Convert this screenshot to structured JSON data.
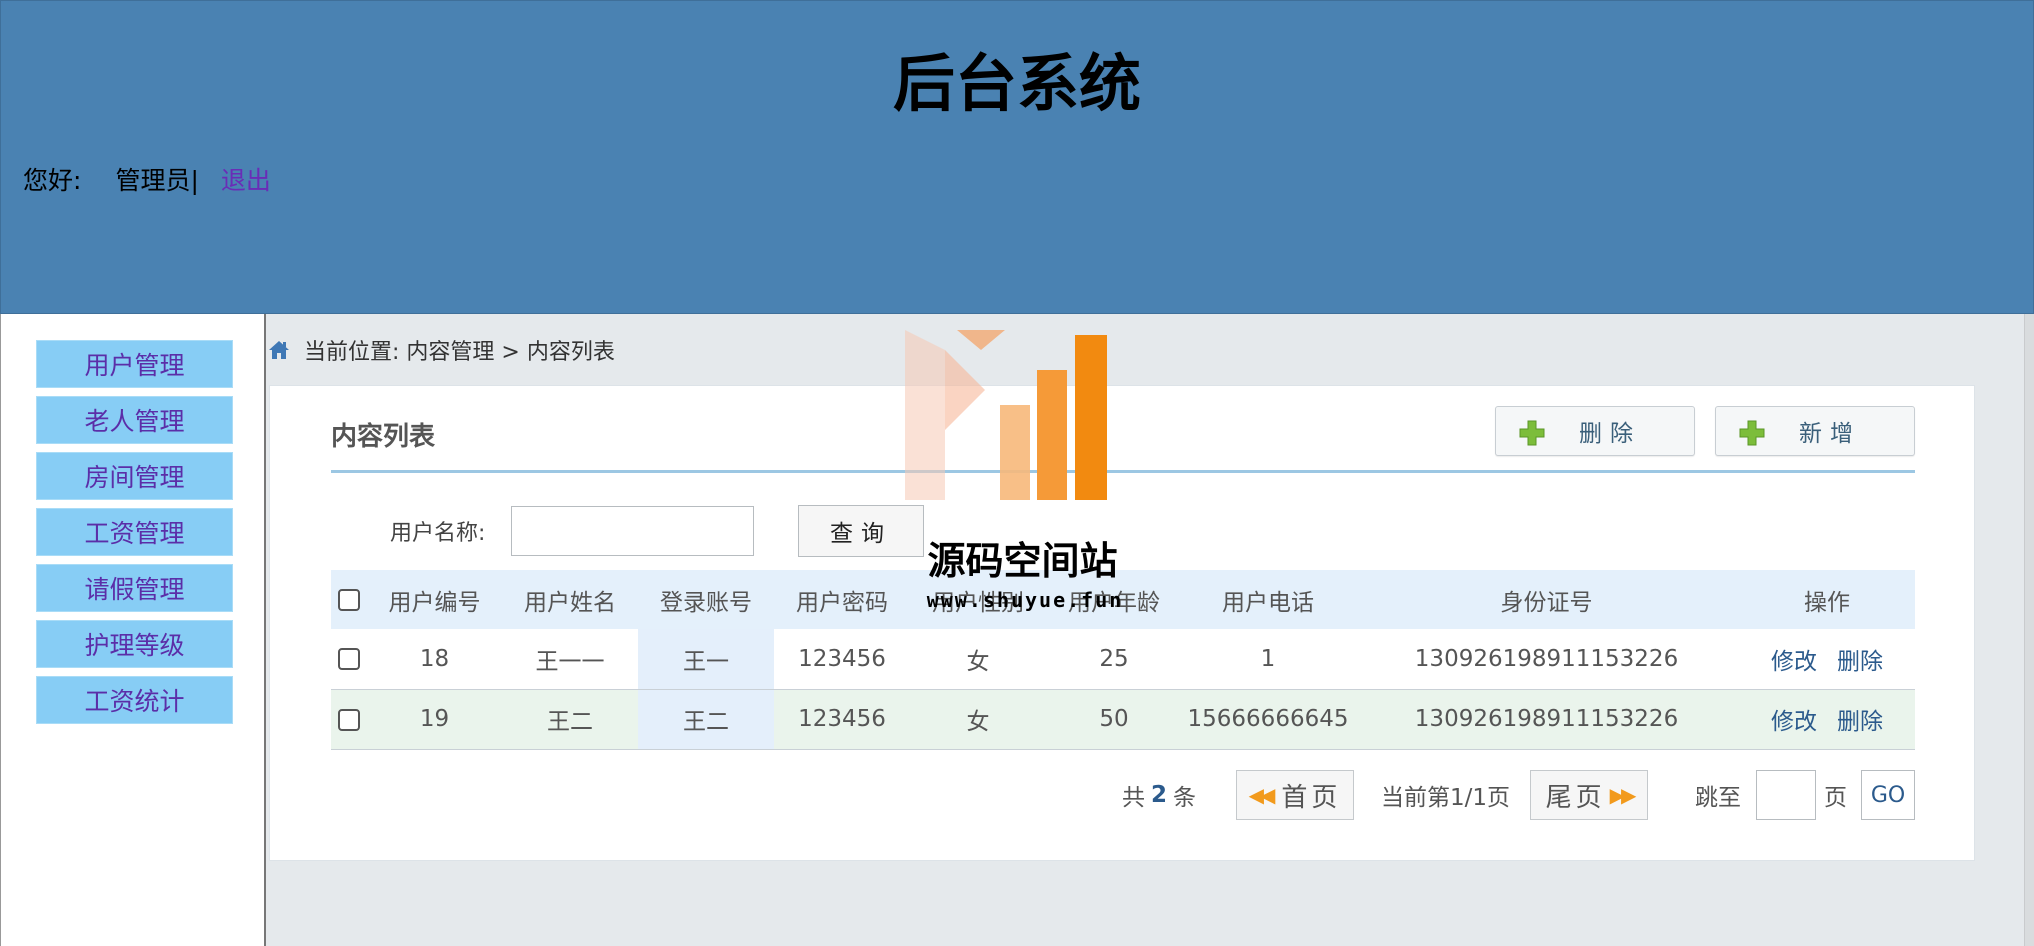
{
  "header": {
    "title": "后台系统",
    "greeting": "您好:",
    "user": "管理员|",
    "logout": "退出"
  },
  "sidebar": {
    "items": [
      {
        "label": "用户管理"
      },
      {
        "label": "老人管理"
      },
      {
        "label": "房间管理"
      },
      {
        "label": "工资管理"
      },
      {
        "label": "请假管理"
      },
      {
        "label": "护理等级"
      },
      {
        "label": "工资统计"
      }
    ]
  },
  "breadcrumb": "当前位置: 内容管理 > 内容列表",
  "panel": {
    "title": "内容列表",
    "delete_label": "删除",
    "add_label": "新增"
  },
  "search": {
    "label": "用户名称:",
    "value": "",
    "placeholder": "",
    "button": "查询"
  },
  "table": {
    "headers": [
      "用户编号",
      "用户姓名",
      "登录账号",
      "用户密码",
      "用户性别",
      "用户年龄",
      "用户电话",
      "身份证号",
      "操作"
    ],
    "rows": [
      {
        "id": "18",
        "name": "王一一",
        "account": "王一",
        "password": "123456",
        "gender": "女",
        "age": "25",
        "phone": "1",
        "idcard": "130926198911153226",
        "edit": "修改",
        "del": "删除"
      },
      {
        "id": "19",
        "name": "王二",
        "account": "王二",
        "password": "123456",
        "gender": "女",
        "age": "50",
        "phone": "15666666645",
        "idcard": "130926198911153226",
        "edit": "修改",
        "del": "删除"
      }
    ]
  },
  "pager": {
    "total_prefix": "共",
    "total_count": "2",
    "total_suffix": "条",
    "first": "首页",
    "current": "当前第1/1页",
    "last": "尾页",
    "jump_label": "跳至",
    "page_unit": "页",
    "go": "GO"
  },
  "watermark": {
    "name": "源码空间站",
    "url": "www.shuyue.fun"
  },
  "colors": {
    "header_bg": "#4a82b2",
    "sidebar_item_bg": "#87cdf5",
    "sidebar_item_text": "#5b2ea8",
    "link": "#2b5a8c",
    "accent_orange": "#f29a1c"
  }
}
